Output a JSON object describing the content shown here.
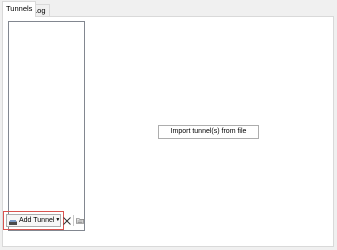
{
  "tabs": [
    {
      "label": "Tunnels",
      "active": true
    },
    {
      "label": "Log",
      "active": false
    }
  ],
  "tunnels_panel": {
    "tunnel_list": {
      "items": []
    },
    "import_button_label": "Import tunnel(s) from file",
    "toolbar": {
      "add_tunnel_label": "Add Tunnel",
      "add_tunnel_icon": "tunnel-icon",
      "dropdown_icon": "chevron-down-icon",
      "delete_icon": "close-icon",
      "export_icon": "folder-export-icon"
    }
  },
  "colors": {
    "highlight": "#d9534f",
    "panel_background": "#ffffff",
    "window_background": "#f0f0f0"
  }
}
